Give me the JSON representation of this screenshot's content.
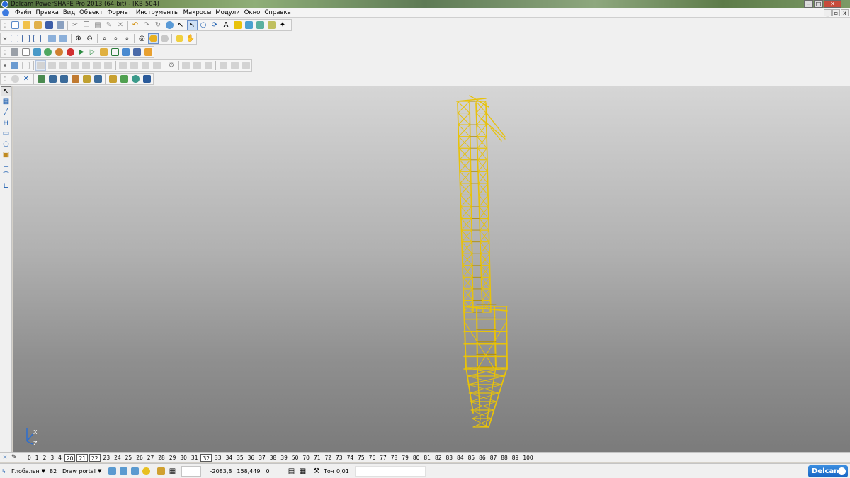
{
  "window": {
    "title": "Delcam PowerSHAPE Pro 2013 (64-bit) - [KB-504]",
    "minimize": "–",
    "maximize": "□",
    "close": "✕",
    "mdi_minimize": "_",
    "mdi_restore": "▫",
    "mdi_close": "x"
  },
  "menu": [
    "Файл",
    "Правка",
    "Вид",
    "Объект",
    "Формат",
    "Инструменты",
    "Макросы",
    "Модули",
    "Окно",
    "Справка"
  ],
  "layers": {
    "items": [
      "0",
      "1",
      "2",
      "3",
      "4",
      "20",
      "21",
      "22",
      "23",
      "24",
      "25",
      "26",
      "27",
      "28",
      "29",
      "30",
      "31",
      "32",
      "33",
      "34",
      "35",
      "36",
      "37",
      "38",
      "39",
      "50",
      "70",
      "71",
      "72",
      "73",
      "74",
      "75",
      "76",
      "77",
      "78",
      "79",
      "80",
      "81",
      "82",
      "83",
      "84",
      "85",
      "86",
      "87",
      "88",
      "89",
      "100"
    ],
    "boxed": [
      "20",
      "21",
      "22",
      "32"
    ]
  },
  "status": {
    "workplane": "Глобальн",
    "layer_number": "82",
    "layer_name": "Draw portal",
    "coord_x": "-2083,8",
    "coord_y": "158,449",
    "coord_z": "0",
    "tolerance_label": "Точ",
    "tolerance_value": "0,01",
    "brand": "Delcam"
  },
  "axis": {
    "x": "X",
    "z": "Z"
  },
  "colors": {
    "tower": "#e8c20a",
    "tower_dark": "#b38f00",
    "accent": "#1765c4"
  }
}
